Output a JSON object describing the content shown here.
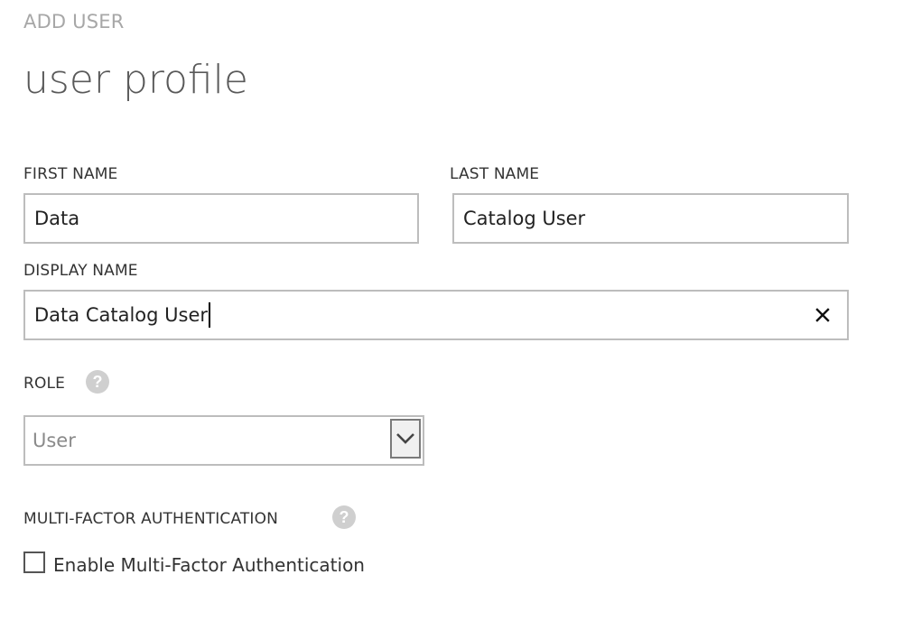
{
  "header": {
    "subtitle": "ADD USER",
    "title": "user profile"
  },
  "form": {
    "first_name": {
      "label": "FIRST NAME",
      "value": "Data"
    },
    "last_name": {
      "label": "LAST NAME",
      "value": "Catalog User"
    },
    "display_name": {
      "label": "DISPLAY NAME",
      "value": "Data Catalog User",
      "clear_icon": "close-icon"
    },
    "role": {
      "label": "ROLE",
      "help_icon": "help-icon",
      "selected": "User",
      "arrow_icon": "chevron-down-icon"
    },
    "mfa": {
      "label": "MULTI-FACTOR AUTHENTICATION",
      "help_icon": "help-icon",
      "checkbox_label": "Enable Multi-Factor Authentication",
      "checked": false
    }
  },
  "colors": {
    "subtitle": "#a7a7a7",
    "title": "#595959",
    "input_border": "#bdbdbd",
    "help_icon": "#cfcfcf"
  }
}
